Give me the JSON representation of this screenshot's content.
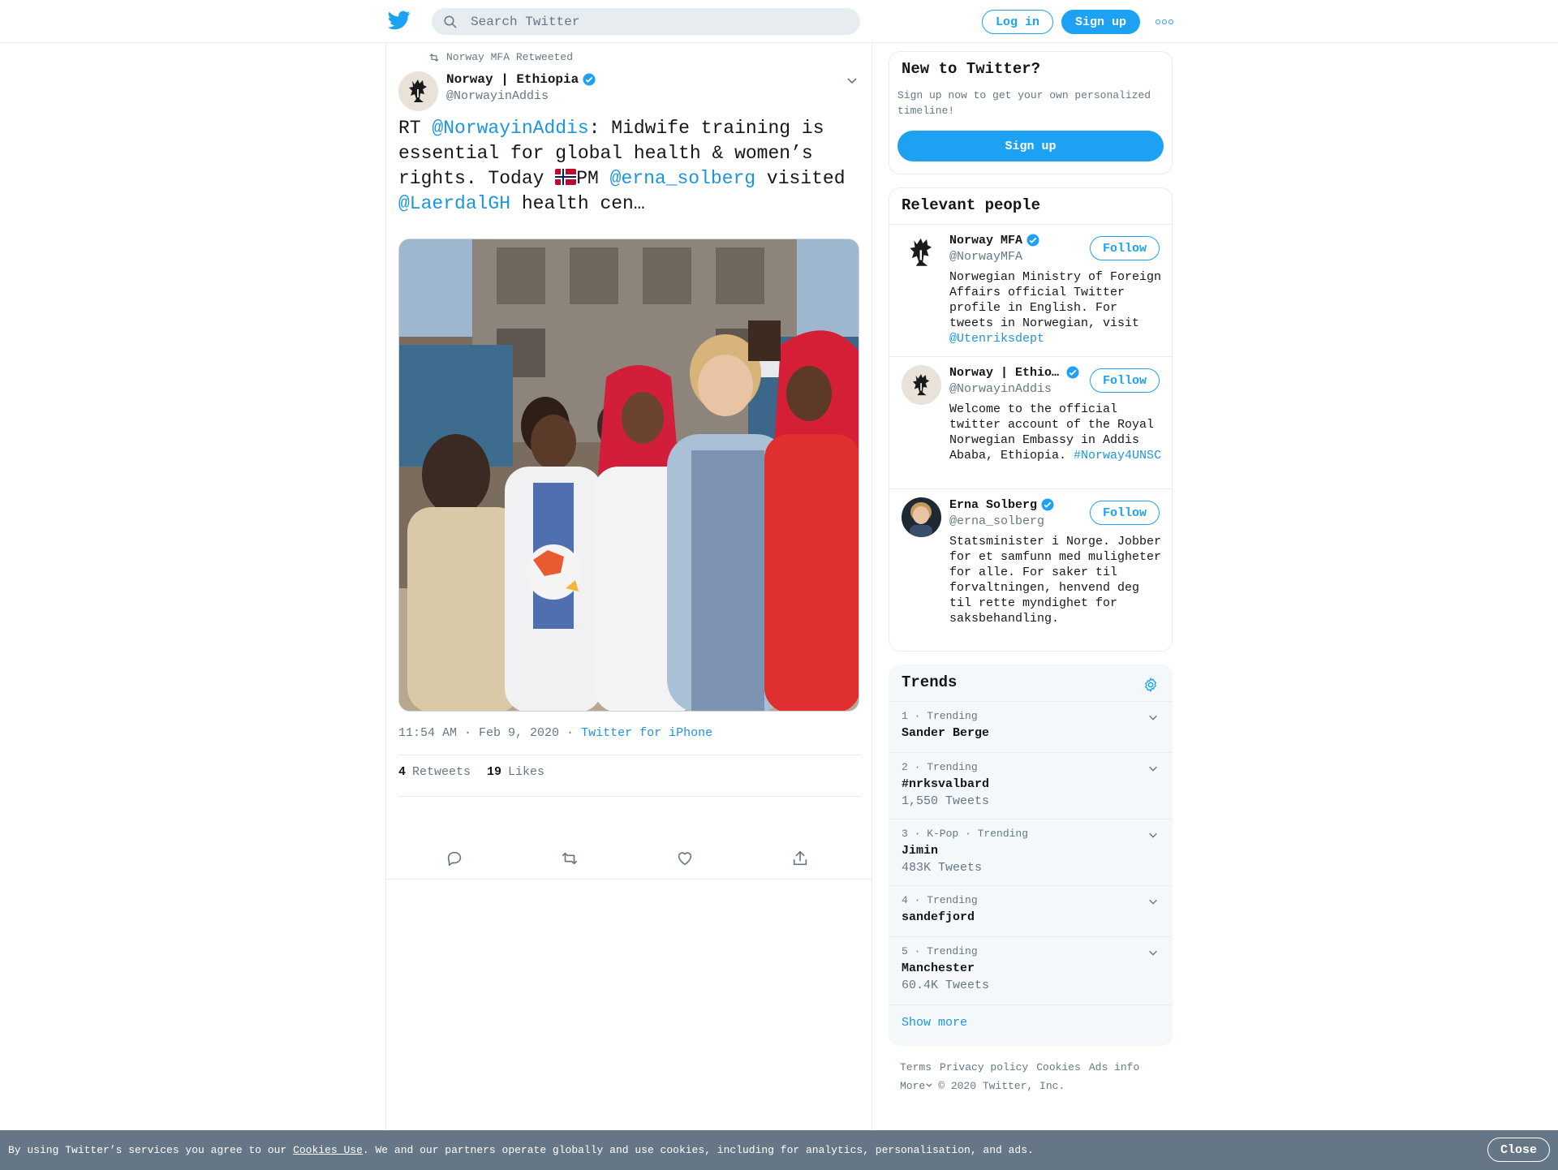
{
  "header": {
    "search_placeholder": "Search Twitter",
    "login_label": "Log in",
    "signup_label": "Sign up",
    "more_icon": "more-icon"
  },
  "tweet": {
    "retweeted_by": "Norway MFA Retweeted",
    "author_name": "Norway | Ethiopia",
    "author_handle": "@NorwayinAddis",
    "text_parts": {
      "rt": "RT ",
      "mention1": "@NorwayinAddis",
      "part1": ": Midwife training is essential for global health & women’s rights. Today ",
      "part2": "PM ",
      "mention2": "@erna_solberg",
      "part3": " visited ",
      "mention3": "@LaerdalGH",
      "part4": " health cen…"
    },
    "timestamp": "11:54 AM · Feb 9, 2020",
    "separator": " · ",
    "source": "Twitter for iPhone",
    "retweets_count": "4",
    "retweets_label": "Retweets",
    "likes_count": "19",
    "likes_label": "Likes"
  },
  "sidebar": {
    "new_to_twitter": {
      "title": "New to Twitter?",
      "text": "Sign up now to get your own personalized timeline!",
      "button": "Sign up"
    },
    "relevant_people": {
      "title": "Relevant people",
      "people": [
        {
          "name": "Norway MFA",
          "handle": "@NorwayMFA",
          "bio": "Norwegian Ministry of Foreign Affairs official Twitter profile in English. For tweets in Norwegian, visit ",
          "bio_link": "@Utenriksdept",
          "follow": "Follow"
        },
        {
          "name": "Norway | Ethio…",
          "handle": "@NorwayinAddis",
          "bio": "Welcome to the official twitter account of the Royal Norwegian Embassy in Addis Ababa, Ethiopia.",
          "bio_link": "#Norway4UNSC",
          "follow": "Follow"
        },
        {
          "name": "Erna Solberg",
          "handle": "@erna_solberg",
          "bio": "Statsminister i Norge. Jobber for et samfunn med muligheter for alle. For saker til forvaltningen, henvend deg til rette myndighet for saksbehandling.",
          "bio_link": "",
          "follow": "Follow"
        }
      ]
    },
    "trends": {
      "title": "Trends",
      "items": [
        {
          "meta": "1 · Trending",
          "name": "Sander Berge",
          "count": ""
        },
        {
          "meta": "2 · Trending",
          "name": "#nrksvalbard",
          "count": "1,550 Tweets"
        },
        {
          "meta": "3 · K-Pop · Trending",
          "name": "Jimin",
          "count": "483K Tweets"
        },
        {
          "meta": "4 · Trending",
          "name": "sandefjord",
          "count": ""
        },
        {
          "meta": "5 · Trending",
          "name": "Manchester",
          "count": "60.4K Tweets"
        }
      ],
      "show_more": "Show more"
    },
    "footer": {
      "terms": "Terms",
      "privacy": "Privacy policy",
      "cookies": "Cookies",
      "ads": "Ads info",
      "more": "More",
      "copyright": "© 2020 Twitter, Inc."
    }
  },
  "cookie_bar": {
    "text_before": "By using Twitter’s services you agree to our ",
    "link": "Cookies Use",
    "text_after": ". We and our partners operate globally and use cookies, including for analytics, personalisation, and ads.",
    "close": "Close"
  },
  "colors": {
    "brand": "#1da1f2",
    "link": "#1b95e0",
    "muted": "#657786",
    "cookie_bar": "#657786"
  }
}
